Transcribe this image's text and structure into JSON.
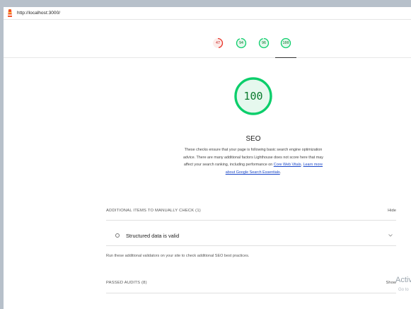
{
  "url_bar": {
    "url": "http://localhost:3000/",
    "logo_icon": "lighthouse-icon"
  },
  "category_gauges": [
    {
      "score": "47",
      "color": "#e8362b",
      "fill_fraction": 0.47
    },
    {
      "score": "94",
      "color": "#0cce6b",
      "fill_fraction": 0.94
    },
    {
      "score": "96",
      "color": "#0cce6b",
      "fill_fraction": 0.96
    },
    {
      "score": "100",
      "color": "#0cce6b",
      "fill_fraction": 1.0
    }
  ],
  "category": {
    "score": "100",
    "score_color": "#0cce6b",
    "title": "SEO",
    "description": "These checks ensure that your page is following basic search engine optimization advice. There are many additional factors Lighthouse does not score here that may affect your search ranking, including performance on ",
    "link_core_web_vitals": "Core Web Vitals",
    "desc_sep": ". ",
    "link_learn_more": "Learn more about Google Search Essentials",
    "desc_end": "."
  },
  "manual_section": {
    "header": "ADDITIONAL ITEMS TO MANUALLY CHECK (1)",
    "toggle_label": "Hide",
    "item_title": "Structured data is valid",
    "item_icon": "circle-outline-icon",
    "expand_icon": "chevron-down-icon",
    "help_text": "Run these additional validators on your site to check additional SEO best practices."
  },
  "passed_section": {
    "header": "PASSED AUDITS (8)",
    "toggle_label": "Show"
  },
  "windows_watermark": {
    "line1": "Activ",
    "line2": "Go to"
  }
}
